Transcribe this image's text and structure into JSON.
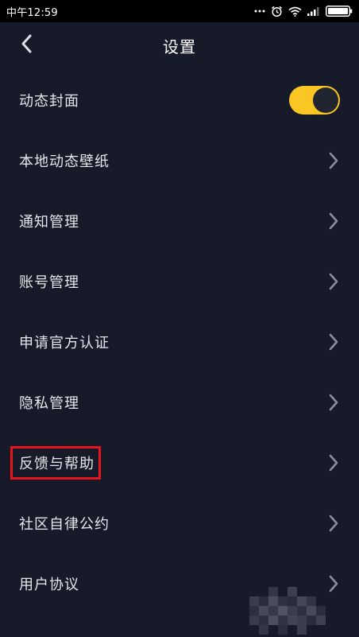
{
  "status_bar": {
    "time": "中午12:59",
    "icons": [
      "more-dots-icon",
      "alarm-icon",
      "wifi-icon",
      "signal-icon",
      "battery-icon"
    ]
  },
  "header": {
    "title": "设置",
    "back_icon": "chevron-left-icon"
  },
  "settings": {
    "items": [
      {
        "label": "动态封面",
        "control": "toggle",
        "toggle_on": true
      },
      {
        "label": "本地动态壁纸",
        "control": "chevron"
      },
      {
        "label": "通知管理",
        "control": "chevron"
      },
      {
        "label": "账号管理",
        "control": "chevron"
      },
      {
        "label": "申请官方认证",
        "control": "chevron"
      },
      {
        "label": "隐私管理",
        "control": "chevron"
      },
      {
        "label": "反馈与帮助",
        "control": "chevron",
        "highlighted": true
      },
      {
        "label": "社区自律公约",
        "control": "chevron"
      },
      {
        "label": "用户协议",
        "control": "chevron"
      }
    ]
  },
  "colors": {
    "background": "#171a28",
    "status_bar": "#000000",
    "text": "#e6e7ec",
    "toggle_on": "#f9c623",
    "chevron": "#8b8f9c",
    "highlight_border": "#e8141b"
  }
}
